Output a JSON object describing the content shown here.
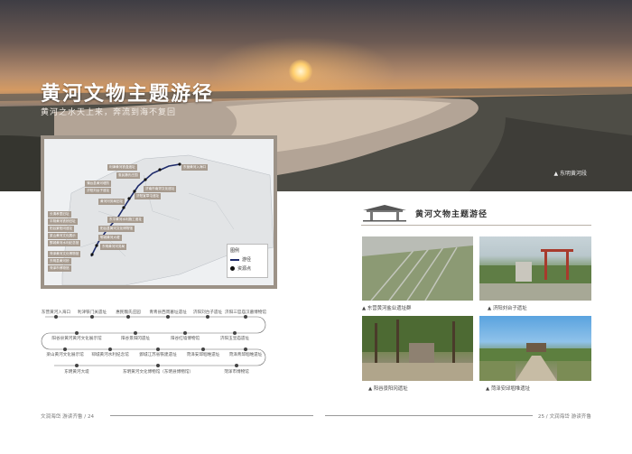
{
  "hero": {
    "title": "黄河文物主题游径",
    "subtitle": "黄河之水天上来，奔流到海不复回",
    "photo_caption": "▲ 东明黄河段"
  },
  "map": {
    "labels": [
      "东营黄河入海口",
      "利津黄河铁盒遗址",
      "惠民魏氏庄园",
      "济南市南郊文化遗址",
      "蒲台县黄河堤防",
      "济阳刘台子遗址",
      "济阳宣章屯遗址",
      "黄河河务局旧址",
      "长清孝里旧址",
      "平阴黄河铁桥旧址",
      "东平黄河水利施工遗址",
      "阳谷景阳冈遗址",
      "阳谷县黄河文化博物馆",
      "梁山黄河文化展示",
      "郓城黄河大堤",
      "鄄城黄河水利纪念馆",
      "东明黄河河务局",
      "菏泽黄河文化博物馆",
      "东明县黄河桥",
      "菏泽市博物馆"
    ],
    "legend": {
      "title": "图例",
      "route": "游径",
      "resource": "资源点"
    }
  },
  "timeline": {
    "row1": [
      "东营黄河入海口",
      "利津铁门关遗址",
      "惠民魏氏庄园",
      "青青县西周墓址遗址",
      "济阳刘台子遗址",
      "济阳三官庙汉墓博物馆"
    ],
    "row2": [
      "阳谷县黄河黄河文化展示馆",
      "阳谷景阳冈遗址",
      "阳谷红墙博物馆",
      "济阳玉皇庙遗址"
    ],
    "row3": [
      "梁山黄河文化展示馆",
      "郓城黄河水利纪念馆",
      "鄄城江苏省铁建遗址",
      "菏泽安邱堌堆遗址",
      "菏泽青邱堌堆遗址"
    ],
    "row4": [
      "东明黄河大堤",
      "东明黄河文化博物馆（东明县博物馆）",
      "菏泽市博物馆"
    ]
  },
  "right": {
    "banner_title": "黄河文物主题游径",
    "photos": [
      {
        "caption": "▲ 东营黄河盐业遗址群"
      },
      {
        "caption": "▲ 济阳刘台子遗址"
      },
      {
        "caption": "▲ 阳谷景阳冈遗址"
      },
      {
        "caption": "▲ 菏泽安邱堌堆遗址"
      }
    ]
  },
  "footer": {
    "left": "文润海岱 游读齐鲁 / 24",
    "right": "25 / 文润海岱 游读齐鲁"
  },
  "colors": {
    "route": "#1d2a6a",
    "label_bg": "#a79b8f",
    "map_frame": "#9c9287"
  }
}
